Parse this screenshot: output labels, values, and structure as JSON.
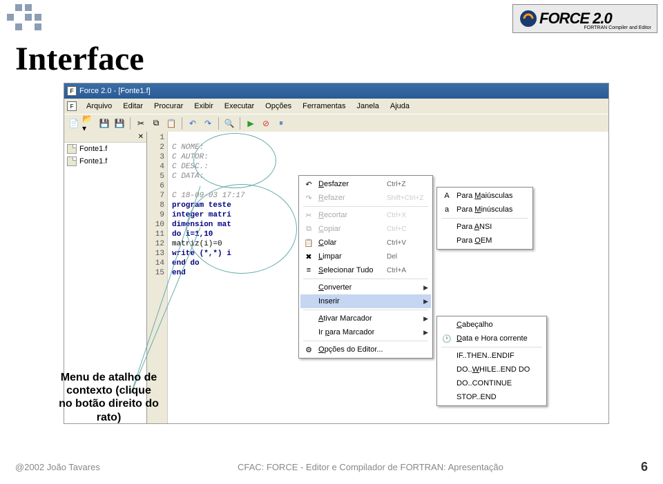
{
  "page": {
    "title": "Interface",
    "callout": "Menu de atalho de contexto (clique no botão direito do rato)"
  },
  "brand": {
    "name": "FORCE 2.0",
    "sub": "FORTRAN Compiler and Editor"
  },
  "window": {
    "title": "Force 2.0 - [Fonte1.f]"
  },
  "menubar": {
    "items": [
      "Arquivo",
      "Editar",
      "Procurar",
      "Exibir",
      "Executar",
      "Opções",
      "Ferramentas",
      "Janela",
      "Ajuda"
    ]
  },
  "sidebar": {
    "files": [
      "Fonte1.f",
      "Fonte1.f"
    ]
  },
  "code": {
    "lines": [
      {
        "n": "1",
        "t": "",
        "cls": ""
      },
      {
        "n": "2",
        "t": "C NOME:",
        "cls": "cmt"
      },
      {
        "n": "3",
        "t": "C AUTOR:",
        "cls": "cmt"
      },
      {
        "n": "4",
        "t": "C DESC.:",
        "cls": "cmt"
      },
      {
        "n": "5",
        "t": "C DATA:",
        "cls": "cmt"
      },
      {
        "n": "6",
        "t": "",
        "cls": ""
      },
      {
        "n": "7",
        "t": "C 18-09-03 17:17",
        "cls": "cmt"
      },
      {
        "n": "8",
        "t": "program teste",
        "cls": "kw"
      },
      {
        "n": "9",
        "t": "integer matri",
        "cls": "kw"
      },
      {
        "n": "10",
        "t": "dimension mat",
        "cls": "kw"
      },
      {
        "n": "11",
        "t": "do i=1,10",
        "cls": "kw"
      },
      {
        "n": "12",
        "t": "matriz(i)=0",
        "cls": ""
      },
      {
        "n": "13",
        "t": "write (*,*) i",
        "cls": "kw"
      },
      {
        "n": "14",
        "t": "end do",
        "cls": "kw"
      },
      {
        "n": "15",
        "t": "end",
        "cls": "kw"
      }
    ]
  },
  "context_main": [
    {
      "icon": "↶",
      "label": "Desfazer",
      "sc": "Ctrl+Z",
      "dis": false,
      "u": "D"
    },
    {
      "icon": "↷",
      "label": "Refazer",
      "sc": "Shift+Ctrl+Z",
      "dis": true,
      "u": "R"
    },
    {
      "sep": true
    },
    {
      "icon": "✂",
      "label": "Recortar",
      "sc": "Ctrl+X",
      "dis": true,
      "u": "R"
    },
    {
      "icon": "⧉",
      "label": "Copiar",
      "sc": "Ctrl+C",
      "dis": true,
      "u": "C"
    },
    {
      "icon": "📋",
      "label": "Colar",
      "sc": "Ctrl+V",
      "dis": false,
      "u": "C"
    },
    {
      "icon": "✖",
      "label": "Limpar",
      "sc": "Del",
      "dis": false,
      "u": "L"
    },
    {
      "icon": "≡",
      "label": "Selecionar Tudo",
      "sc": "Ctrl+A",
      "dis": false,
      "u": "S"
    },
    {
      "sep": true
    },
    {
      "icon": "",
      "label": "Converter",
      "sc": "",
      "dis": false,
      "arr": true,
      "u": "C"
    },
    {
      "icon": "",
      "label": "Inserir",
      "sc": "",
      "dis": false,
      "arr": true,
      "hl": true,
      "u": ""
    },
    {
      "sep": true
    },
    {
      "icon": "",
      "label": "Ativar Marcador",
      "sc": "",
      "dis": false,
      "arr": true,
      "u": "A"
    },
    {
      "icon": "",
      "label": "Ir para Marcador",
      "sc": "",
      "dis": false,
      "arr": true,
      "u": "p"
    },
    {
      "sep": true
    },
    {
      "icon": "⚙",
      "label": "Opções do Editor...",
      "sc": "",
      "dis": false,
      "u": "O"
    }
  ],
  "context_convert": [
    {
      "icon": "A",
      "label": "Para Maiúsculas",
      "u": "M"
    },
    {
      "icon": "a",
      "label": "Para Minúsculas",
      "u": "M"
    },
    {
      "sep": true
    },
    {
      "icon": "",
      "label": "Para ANSI",
      "u": "A"
    },
    {
      "icon": "",
      "label": "Para OEM",
      "u": "O"
    }
  ],
  "context_insert": [
    {
      "icon": "",
      "label": "Cabeçalho",
      "u": "C"
    },
    {
      "icon": "🕐",
      "label": "Data e Hora corrente",
      "u": "D"
    },
    {
      "sep": true
    },
    {
      "icon": "",
      "label": "IF..THEN..ENDIF"
    },
    {
      "icon": "",
      "label": "DO..WHILE..END DO",
      "u": "W"
    },
    {
      "icon": "",
      "label": "DO..CONTINUE"
    },
    {
      "icon": "",
      "label": "STOP..END"
    }
  ],
  "footer": {
    "copyright": "@2002 João Tavares",
    "center": "CFAC: FORCE - Editor e Compilador de FORTRAN: Apresentação",
    "page": "6"
  }
}
